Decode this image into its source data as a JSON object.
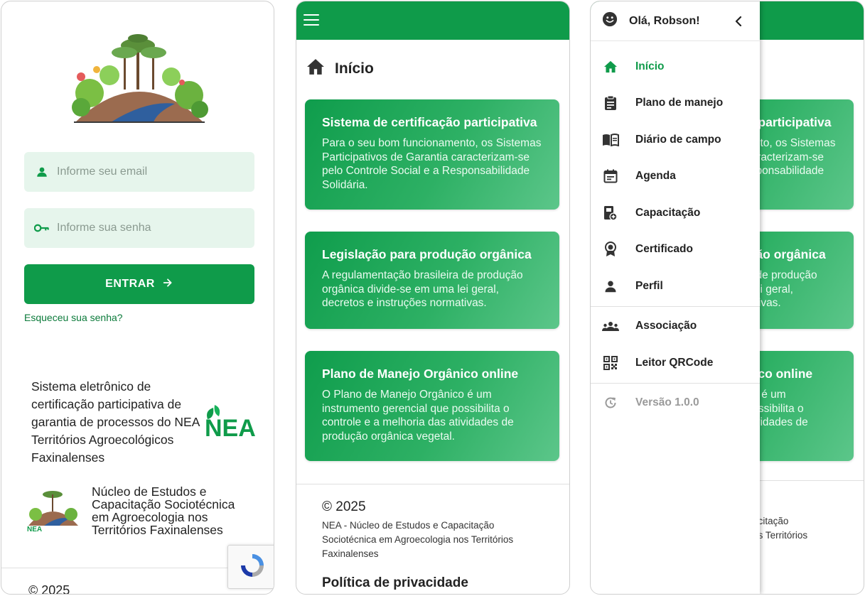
{
  "login": {
    "email_placeholder": "Informe seu email",
    "password_placeholder": "Informe sua senha",
    "enter_label": "ENTRAR",
    "forgot_label": "Esqueceu sua senha?",
    "system_text": "Sistema eletrônico de certificação participativa de garantia de processos do NEA Territórios Agroecológicos Faxinalenses",
    "nea_logo_text": "NEA",
    "nucleo_text": "Núcleo de Estudos e Capacitação Sociotécnica em Agroecologia nos Territórios Faxinalenses",
    "copyright": "© 2025"
  },
  "home": {
    "title": "Início",
    "cards": [
      {
        "title": "Sistema de certificação participativa",
        "text": "Para o seu bom funcionamento, os Sistemas Participativos de Garantia caracterizam-se pelo Controle Social e a Responsabilidade Solidária."
      },
      {
        "title": "Legislação para produção orgânica",
        "text": "A regulamentação brasileira de produção orgânica divide-se em uma lei geral, decretos e instruções normativas."
      },
      {
        "title": "Plano de Manejo Orgânico online",
        "text": "O Plano de Manejo Orgânico é um instrumento gerencial que possibilita o controle e a melhoria das atividades de produção orgânica vegetal."
      }
    ],
    "copyright": "© 2025",
    "nea_text": "NEA - Núcleo de Estudos e Capacitação Sociotécnica em Agroecologia nos Territórios Faxinalenses",
    "policy": "Política de privacidade"
  },
  "drawer": {
    "greeting": "Olá, Robson!",
    "items": [
      {
        "label": "Início",
        "icon": "home-icon"
      },
      {
        "label": "Plano de manejo",
        "icon": "clipboard-icon"
      },
      {
        "label": "Diário de campo",
        "icon": "book-icon"
      },
      {
        "label": "Agenda",
        "icon": "calendar-icon"
      },
      {
        "label": "Capacitação",
        "icon": "training-icon"
      },
      {
        "label": "Certificado",
        "icon": "certificate-icon"
      },
      {
        "label": "Perfil",
        "icon": "person-icon"
      },
      {
        "label": "Associação",
        "icon": "group-icon"
      },
      {
        "label": "Leitor QRCode",
        "icon": "qrcode-icon"
      },
      {
        "label": "Versão 1.0.0",
        "icon": "refresh-icon"
      }
    ]
  },
  "colors": {
    "brand_green": "#0f9b4a",
    "field_bg": "#e6f5ec"
  }
}
